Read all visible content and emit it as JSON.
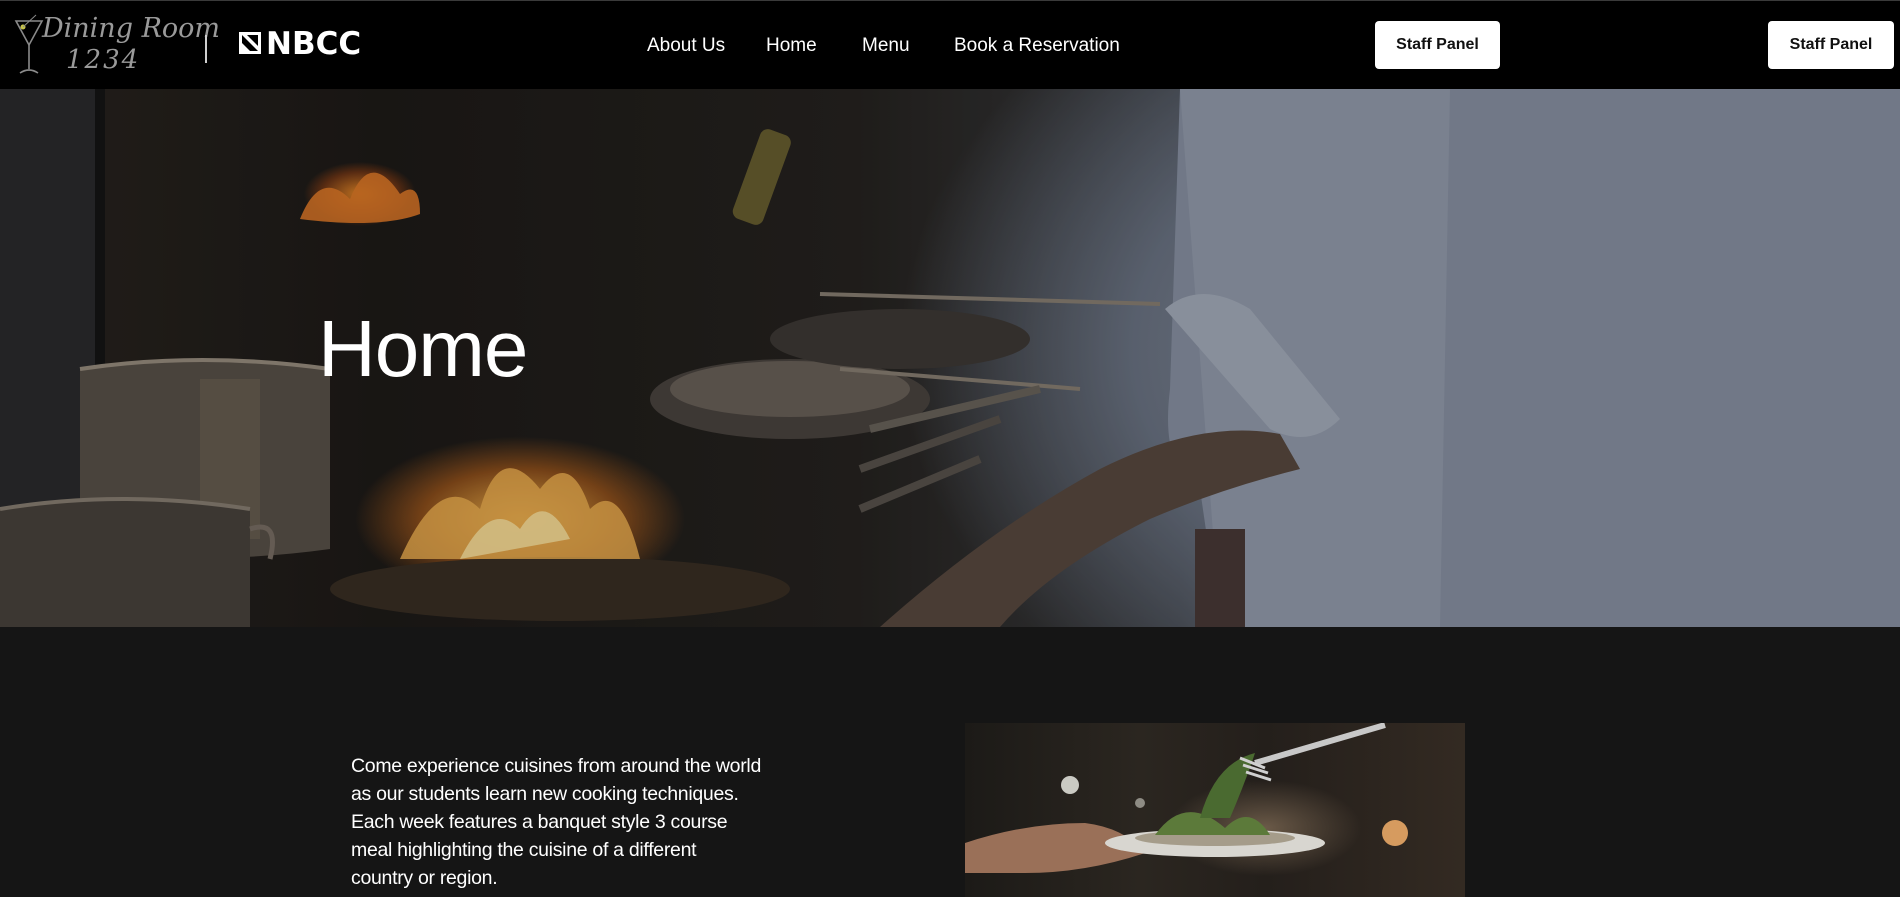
{
  "header": {
    "logo": {
      "dining_line1": "Dining Room",
      "dining_line2": "1234",
      "school": "NBCC"
    },
    "nav": [
      {
        "label": "About Us"
      },
      {
        "label": "Home"
      },
      {
        "label": "Menu"
      },
      {
        "label": "Book a Reservation"
      }
    ],
    "staff_button_1": "Staff Panel",
    "staff_button_2": "Staff Panel"
  },
  "hero": {
    "title": "Home"
  },
  "intro": {
    "text": "Come experience cuisines from around the world as our students learn new cooking techniques. Each week features a banquet style 3 course meal highlighting the cuisine of a different country or region."
  },
  "colors": {
    "header_bg": "#000000",
    "page_bg": "#151515",
    "button_bg": "#ffffff",
    "text": "#ffffff"
  }
}
